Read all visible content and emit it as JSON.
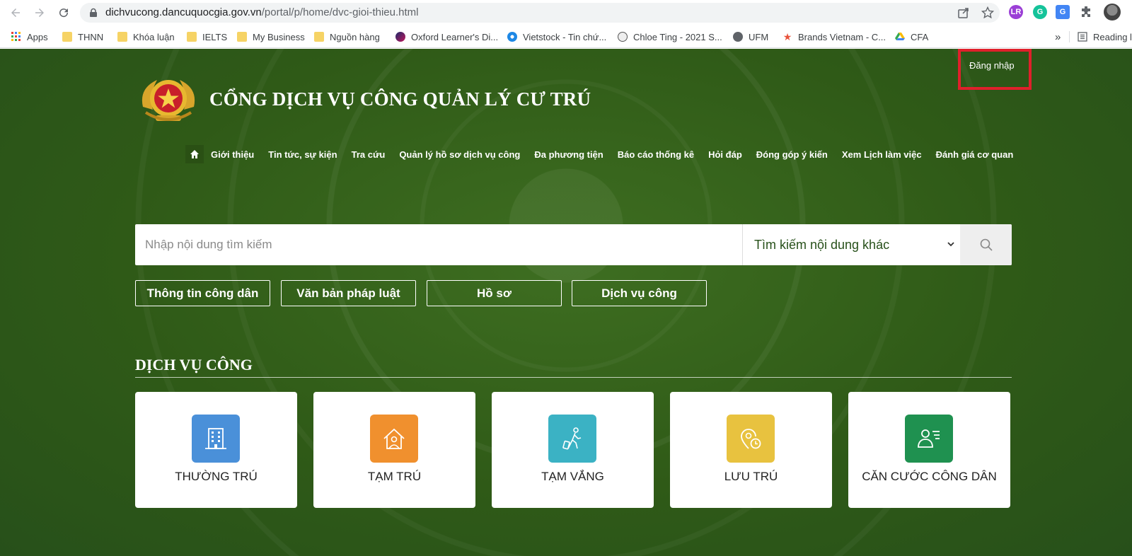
{
  "browser": {
    "url_host": "dichvucong.dancuquocgia.gov.vn",
    "url_path": "/portal/p/home/dvc-gioi-thieu.html",
    "bookmarks": [
      {
        "label": "Apps",
        "icon": "apps-grid-icon"
      },
      {
        "label": "THNN",
        "icon": "folder-icon"
      },
      {
        "label": "Khóa luận",
        "icon": "folder-icon"
      },
      {
        "label": "IELTS",
        "icon": "folder-icon"
      },
      {
        "label": "My Business",
        "icon": "folder-icon"
      },
      {
        "label": "Nguồn hàng",
        "icon": "folder-icon"
      },
      {
        "label": "Oxford Learner's Di...",
        "icon": "oxford-icon"
      },
      {
        "label": "Vietstock - Tin chứ...",
        "icon": "vietstock-icon"
      },
      {
        "label": "Chloe Ting - 2021 S...",
        "icon": "chloe-icon"
      },
      {
        "label": "UFM",
        "icon": "globe-icon"
      },
      {
        "label": "Brands Vietnam - C...",
        "icon": "star-icon"
      },
      {
        "label": "CFA",
        "icon": "drive-icon"
      }
    ],
    "overflow": "»",
    "reading_list": "Reading l"
  },
  "header": {
    "login_label": "Đăng nhập",
    "site_title": "CỔNG DỊCH VỤ CÔNG QUẢN LÝ CƯ TRÚ"
  },
  "menu": {
    "items": [
      "Giới thiệu",
      "Tin tức, sự kiện",
      "Tra cứu",
      "Quản lý hồ sơ dịch vụ công",
      "Đa phương tiện",
      "Báo cáo thống kê",
      "Hỏi đáp",
      "Đóng góp ý kiến",
      "Xem Lịch làm việc",
      "Đánh giá cơ quan"
    ]
  },
  "search": {
    "placeholder": "Nhập nội dung tìm kiếm",
    "select_value": "Tìm kiếm nội dung khác"
  },
  "quick_buttons": [
    "Thông tin công dân",
    "Văn bản pháp luật",
    "Hồ sơ",
    "Dịch vụ công"
  ],
  "services": {
    "title": "DỊCH VỤ CÔNG",
    "cards": [
      {
        "label": "THƯỜNG TRÚ",
        "icon": "building-icon",
        "color": "#4a90d9"
      },
      {
        "label": "TẠM TRÚ",
        "icon": "house-person-icon",
        "color": "#f0902e"
      },
      {
        "label": "TẠM VẮNG",
        "icon": "traveler-icon",
        "color": "#3bb2c4"
      },
      {
        "label": "LƯU TRÚ",
        "icon": "location-clock-icon",
        "color": "#e8c23f"
      },
      {
        "label": "CĂN CƯỚC CÔNG DÂN",
        "icon": "id-card-icon",
        "color": "#1f9150"
      }
    ]
  },
  "colors": {
    "page_green": "#2f5a17",
    "login_highlight": "#e0202b"
  }
}
